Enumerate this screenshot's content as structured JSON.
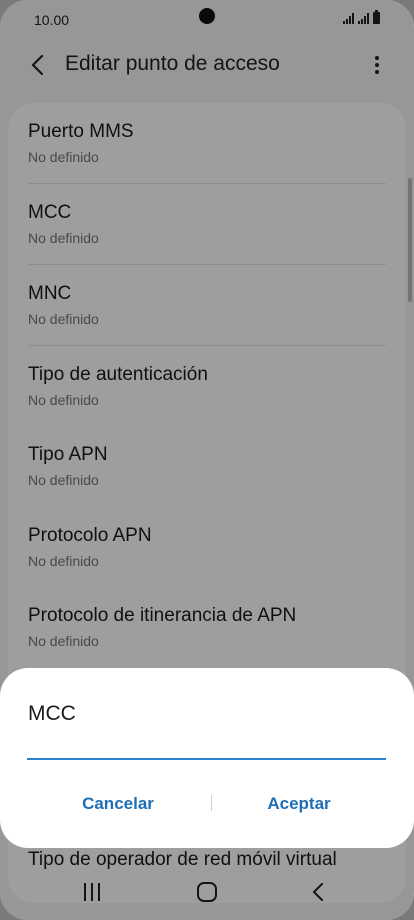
{
  "status": {
    "time": "10.00"
  },
  "header": {
    "title": "Editar punto de acceso"
  },
  "list": {
    "items": [
      {
        "title": "Puerto MMS",
        "value": "No definido"
      },
      {
        "title": "MCC",
        "value": "No definido"
      },
      {
        "title": "MNC",
        "value": "No definido"
      },
      {
        "title": "Tipo de autenticación",
        "value": "No definido"
      },
      {
        "title": "Tipo APN",
        "value": "No definido"
      },
      {
        "title": "Protocolo APN",
        "value": "No definido"
      },
      {
        "title": "Protocolo de itinerancia de APN",
        "value": "No definido"
      },
      {
        "title": "Tipo de operador de red móvil virtual",
        "value": ""
      }
    ]
  },
  "dialog": {
    "title": "MCC",
    "input_value": "",
    "cancel_label": "Cancelar",
    "accept_label": "Aceptar"
  },
  "colors": {
    "accent": "#2b82cf",
    "button_text": "#1f6fb5"
  }
}
